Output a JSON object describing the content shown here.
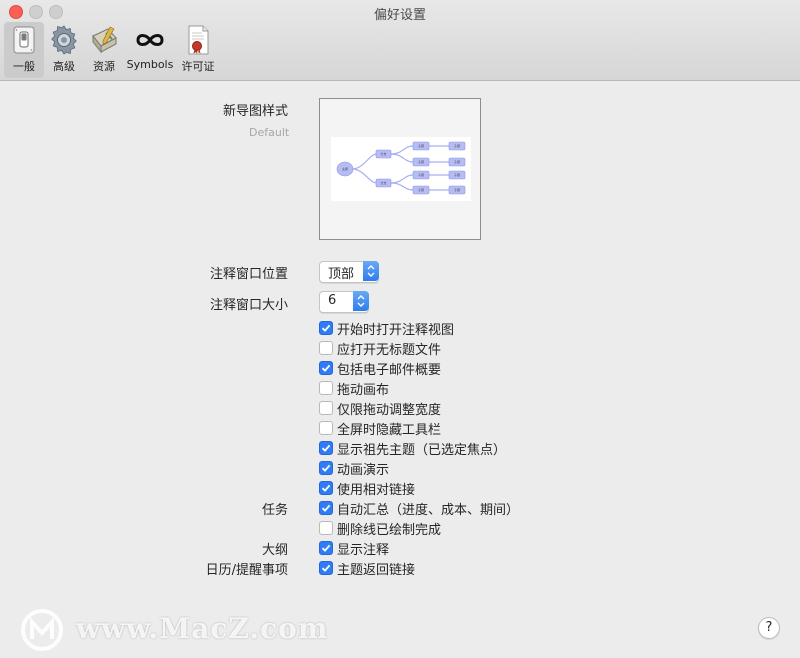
{
  "window": {
    "title": "偏好设置"
  },
  "toolbar": {
    "items": [
      {
        "label": "一般",
        "icon": "switch-icon",
        "active": true
      },
      {
        "label": "高级",
        "icon": "gear-icon",
        "active": false
      },
      {
        "label": "资源",
        "icon": "resources-icon",
        "active": false
      },
      {
        "label": "Symbols",
        "icon": "infinity-icon",
        "active": false
      },
      {
        "label": "许可证",
        "icon": "license-icon",
        "active": false
      }
    ]
  },
  "form": {
    "map_style_label": "新导图样式",
    "map_style_value": "Default",
    "map_node_labels": {
      "root": "主题",
      "branch": "分支",
      "sub": "子题"
    },
    "note_position_label": "注释窗口位置",
    "note_position_value": "顶部",
    "note_size_label": "注释窗口大小",
    "note_size_value": "6",
    "checkboxes": [
      {
        "label": "开始时打开注释视图",
        "checked": true
      },
      {
        "label": "应打开无标题文件",
        "checked": false
      },
      {
        "label": "包括电子邮件概要",
        "checked": true
      },
      {
        "label": "拖动画布",
        "checked": false
      },
      {
        "label": "仅限拖动调整宽度",
        "checked": false
      },
      {
        "label": "全屏时隐藏工具栏",
        "checked": false
      },
      {
        "label": "显示祖先主题（已选定焦点）",
        "checked": true
      },
      {
        "label": "动画演示",
        "checked": true
      },
      {
        "label": "使用相对链接",
        "checked": true
      }
    ],
    "tasks_label": "任务",
    "tasks": [
      {
        "label": "自动汇总（进度、成本、期间）",
        "checked": true
      },
      {
        "label": "删除线已绘制完成",
        "checked": false
      }
    ],
    "outline_label": "大纲",
    "outline": [
      {
        "label": "显示注释",
        "checked": true
      }
    ],
    "calendar_label": "日历/提醒事项",
    "calendar": [
      {
        "label": "主题返回链接",
        "checked": true
      }
    ]
  },
  "help": {
    "label": "?"
  },
  "watermark": {
    "text": "www.MacZ.com"
  },
  "colors": {
    "accent": "#2f7cf6",
    "close": "#fc5f57",
    "node": "#a6aef2"
  }
}
